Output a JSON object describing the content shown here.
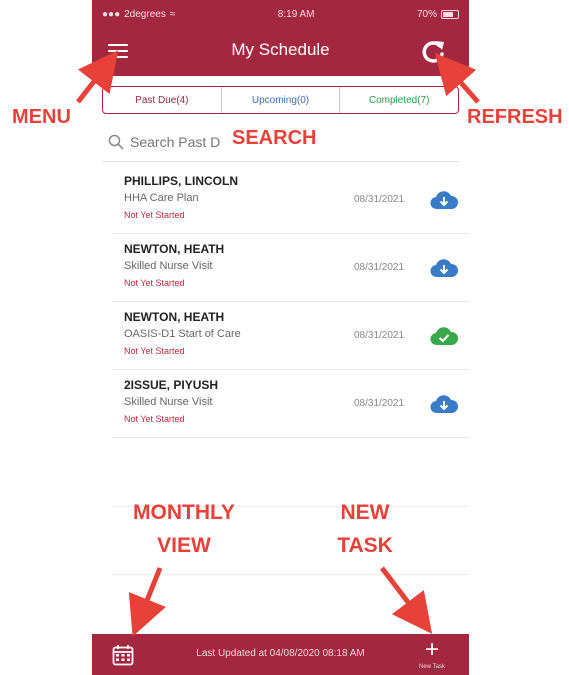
{
  "status_bar": {
    "carrier": "2degrees",
    "time": "8:19 AM",
    "battery": "70%",
    "battery_level": 0.7
  },
  "header": {
    "title": "My Schedule",
    "menu_icon": "hamburger-icon",
    "refresh_icon": "refresh-icon"
  },
  "tabs": [
    {
      "label": "Past Due(4)",
      "color": "#a3283f"
    },
    {
      "label": "Upcoming(0)",
      "color": "#3a6fb0"
    },
    {
      "label": "Completed(7)",
      "color": "#2e9a4a"
    }
  ],
  "search": {
    "placeholder": "Search Past D"
  },
  "tasks": [
    {
      "name": "PHILLIPS, LINCOLN",
      "visit": "HHA Care Plan",
      "status": "Not Yet Started",
      "date": "08/31/2021",
      "cloud_icon": "cloud-download-icon",
      "cloud_color": "#3a7bc8"
    },
    {
      "name": "NEWTON, HEATH",
      "visit": "Skilled Nurse Visit",
      "status": "Not Yet Started",
      "date": "08/31/2021",
      "cloud_icon": "cloud-download-icon",
      "cloud_color": "#3a7bc8"
    },
    {
      "name": "NEWTON, HEATH",
      "visit": "OASIS-D1 Start of Care",
      "status": "Not Yet Started",
      "date": "08/31/2021",
      "cloud_icon": "cloud-check-icon",
      "cloud_color": "#3aa84a"
    },
    {
      "name": "2ISSUE, PIYUSH",
      "visit": "Skilled Nurse Visit",
      "status": "Not Yet Started",
      "date": "08/31/2021",
      "cloud_icon": "cloud-download-icon",
      "cloud_color": "#3a7bc8"
    }
  ],
  "footer": {
    "last_updated": "Last Updated at 04/08/2020 08:18 AM",
    "new_task_label": "New Task",
    "calendar_icon": "calendar-icon",
    "plus_icon": "plus-icon"
  },
  "annotations": {
    "menu": "MENU",
    "refresh": "REFRESH",
    "search": "SEARCH",
    "monthly_line1": "MONTHLY",
    "monthly_line2": "VIEW",
    "newtask_line1": "NEW",
    "newtask_line2": "TASK",
    "color": "#e8413a"
  },
  "colors": {
    "brand": "#a3283f",
    "status_red": "#c0293f"
  }
}
